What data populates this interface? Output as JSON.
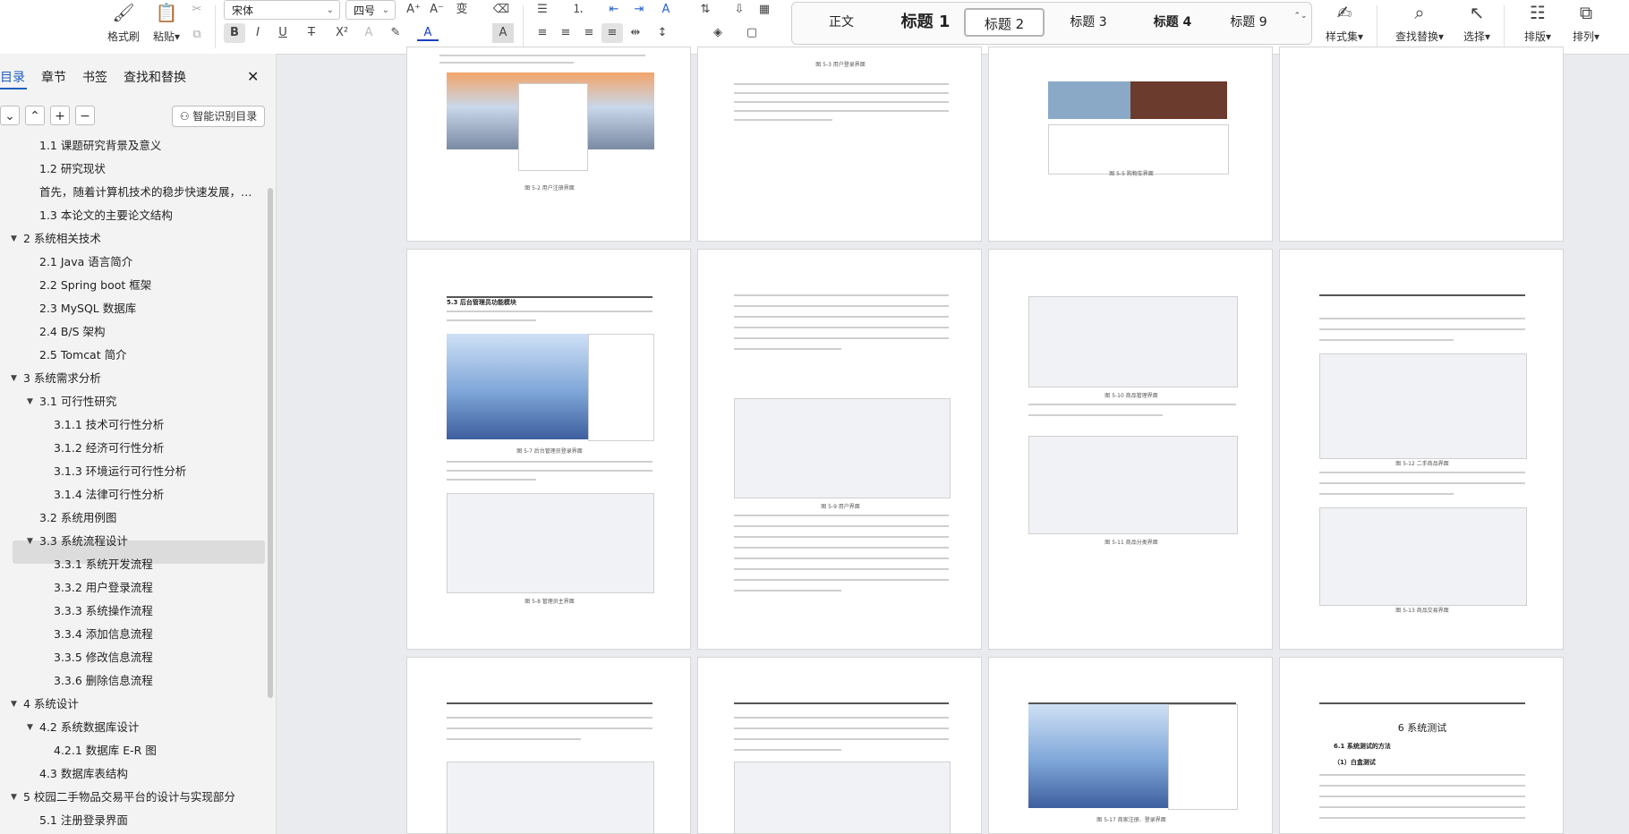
{
  "ribbon": {
    "format_painter": "格式刷",
    "paste": "粘贴",
    "font_name": "宋体",
    "font_size": "四号",
    "styles": [
      "正文",
      "标题 1",
      "标题 2",
      "标题 3",
      "标题 4",
      "标题 9"
    ],
    "selected_style": "标题 2",
    "style_set": "样式集",
    "find_replace": "查找替换",
    "select": "选择",
    "layout": "排版",
    "arrange": "排列"
  },
  "panel": {
    "tabs": [
      "目录",
      "章节",
      "书签",
      "查找和替换"
    ],
    "ai_button": "智能识别目录",
    "toc": [
      {
        "text": "1.1 课题研究背景及意义",
        "level": 2
      },
      {
        "text": "1.2 研究现状",
        "level": 2
      },
      {
        "text": "首先，随着计算机技术的稳步快速发展，各类...",
        "level": 2
      },
      {
        "text": "1.3 本论文的主要论文结构",
        "level": 2
      },
      {
        "text": "2 系统相关技术",
        "level": 1,
        "expand": true
      },
      {
        "text": "2.1 Java 语言简介",
        "level": 2
      },
      {
        "text": "2.2    Spring boot 框架",
        "level": 2
      },
      {
        "text": "2.3 MySQL 数据库",
        "level": 2
      },
      {
        "text": "2.4 B/S 架构",
        "level": 2
      },
      {
        "text": "2.5 Tomcat 简介",
        "level": 2
      },
      {
        "text": "3 系统需求分析",
        "level": 1,
        "expand": true
      },
      {
        "text": "3.1 可行性研究",
        "level": 2,
        "expand": true
      },
      {
        "text": "3.1.1  技术可行性分析",
        "level": 3
      },
      {
        "text": "3.1.2  经济可行性分析",
        "level": 3
      },
      {
        "text": "3.1.3  环境运行可行性分析",
        "level": 3
      },
      {
        "text": "3.1.4  法律可行性分析",
        "level": 3
      },
      {
        "text": "3.2 系统用例图",
        "level": 2
      },
      {
        "text": "3.3 系统流程设计",
        "level": 2,
        "expand": true,
        "selected": true
      },
      {
        "text": "3.3.1  系统开发流程",
        "level": 3
      },
      {
        "text": "3.3.2  用户登录流程",
        "level": 3
      },
      {
        "text": "3.3.3  系统操作流程",
        "level": 3
      },
      {
        "text": "3.3.4  添加信息流程",
        "level": 3
      },
      {
        "text": "3.3.5  修改信息流程",
        "level": 3
      },
      {
        "text": "3.3.6  删除信息流程",
        "level": 3
      },
      {
        "text": "4 系统设计",
        "level": 1,
        "expand": true
      },
      {
        "text": "4.2 系统数据库设计",
        "level": 2,
        "expand": true
      },
      {
        "text": "4.2.1 数据库 E-R 图",
        "level": 3
      },
      {
        "text": "4.3 数据库表结构",
        "level": 2
      },
      {
        "text": "5  校园二手物品交易平台的设计与实现部分",
        "level": 1,
        "expand": true
      },
      {
        "text": "5.1 注册登录界面",
        "level": 2
      }
    ]
  },
  "pages": {
    "row1_captions": [
      "图 5-2  用户注册界面",
      "图 5-3 用户登录界面",
      "图 5-5 购物车界面"
    ],
    "section_heading": "5.3 后台管理员功能模块",
    "row2_captions": [
      "图 5-7  后台管理员登录界面",
      "图 5-8  管理员主界面",
      "图 5-9 用户界面",
      "图 5-10 商品管理界面",
      "图 5-11 商品分类界面",
      "图 5-12 二手商品界面",
      "图 5-13 商品交易界面"
    ],
    "chapter6_title": "6 系统测试",
    "chapter6_sub1": "6.1 系统测试的方法",
    "chapter6_sub2": "（1）白盒测试",
    "row3_caption": "图 5-17 商家注册、登录界面"
  }
}
